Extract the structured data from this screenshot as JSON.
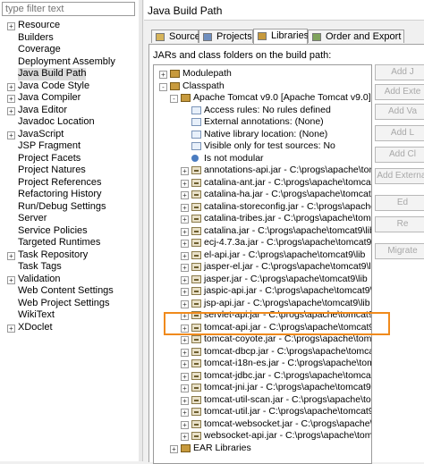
{
  "filter": {
    "placeholder": "type filter text"
  },
  "nav": [
    {
      "label": "Resource",
      "exp": "+"
    },
    {
      "label": "Builders",
      "exp": ""
    },
    {
      "label": "Coverage",
      "exp": ""
    },
    {
      "label": "Deployment Assembly",
      "exp": ""
    },
    {
      "label": "Java Build Path",
      "exp": "",
      "selected": true
    },
    {
      "label": "Java Code Style",
      "exp": "+"
    },
    {
      "label": "Java Compiler",
      "exp": "+"
    },
    {
      "label": "Java Editor",
      "exp": "+"
    },
    {
      "label": "Javadoc Location",
      "exp": ""
    },
    {
      "label": "JavaScript",
      "exp": "+"
    },
    {
      "label": "JSP Fragment",
      "exp": ""
    },
    {
      "label": "Project Facets",
      "exp": ""
    },
    {
      "label": "Project Natures",
      "exp": ""
    },
    {
      "label": "Project References",
      "exp": ""
    },
    {
      "label": "Refactoring History",
      "exp": ""
    },
    {
      "label": "Run/Debug Settings",
      "exp": ""
    },
    {
      "label": "Server",
      "exp": ""
    },
    {
      "label": "Service Policies",
      "exp": ""
    },
    {
      "label": "Targeted Runtimes",
      "exp": ""
    },
    {
      "label": "Task Repository",
      "exp": "+"
    },
    {
      "label": "Task Tags",
      "exp": ""
    },
    {
      "label": "Validation",
      "exp": "+"
    },
    {
      "label": "Web Content Settings",
      "exp": ""
    },
    {
      "label": "Web Project Settings",
      "exp": ""
    },
    {
      "label": "WikiText",
      "exp": ""
    },
    {
      "label": "XDoclet",
      "exp": "+"
    }
  ],
  "header": {
    "title": "Java Build Path"
  },
  "tabs": [
    {
      "label": "Source",
      "icon": "source-icon"
    },
    {
      "label": "Projects",
      "icon": "projects-icon"
    },
    {
      "label": "Libraries",
      "icon": "libraries-icon",
      "active": true
    },
    {
      "label": "Order and Export",
      "icon": "order-icon"
    }
  ],
  "content": {
    "jars_label": "JARs and class folders on the build path:"
  },
  "tree": [
    {
      "level": 0,
      "exp": "+",
      "icon": "lib",
      "text": "Modulepath"
    },
    {
      "level": 0,
      "exp": "-",
      "icon": "lib",
      "text": "Classpath"
    },
    {
      "level": 1,
      "exp": "-",
      "icon": "lib",
      "text": "Apache Tomcat v9.0 [Apache Tomcat v9.0]"
    },
    {
      "level": 2,
      "exp": "",
      "icon": "cross",
      "text": "Access rules: No rules defined"
    },
    {
      "level": 2,
      "exp": "",
      "icon": "cross",
      "text": "External annotations: (None)"
    },
    {
      "level": 2,
      "exp": "",
      "icon": "cross",
      "text": "Native library location: (None)"
    },
    {
      "level": 2,
      "exp": "",
      "icon": "cross",
      "text": "Visible only for test sources: No"
    },
    {
      "level": 2,
      "exp": "",
      "icon": "dot",
      "text": "Is not modular"
    },
    {
      "level": 2,
      "exp": "+",
      "icon": "jar",
      "text": "annotations-api.jar - C:\\progs\\apache\\tomcat"
    },
    {
      "level": 2,
      "exp": "+",
      "icon": "jar",
      "text": "catalina-ant.jar - C:\\progs\\apache\\tomcat9\\li"
    },
    {
      "level": 2,
      "exp": "+",
      "icon": "jar",
      "text": "catalina-ha.jar - C:\\progs\\apache\\tomcat9\\lib"
    },
    {
      "level": 2,
      "exp": "+",
      "icon": "jar",
      "text": "catalina-storeconfig.jar - C:\\progs\\apache\\to"
    },
    {
      "level": 2,
      "exp": "+",
      "icon": "jar",
      "text": "catalina-tribes.jar - C:\\progs\\apache\\tomca"
    },
    {
      "level": 2,
      "exp": "+",
      "icon": "jar",
      "text": "catalina.jar - C:\\progs\\apache\\tomcat9\\lib"
    },
    {
      "level": 2,
      "exp": "+",
      "icon": "jar",
      "text": "ecj-4.7.3a.jar - C:\\progs\\apache\\tomcat9\\lib"
    },
    {
      "level": 2,
      "exp": "+",
      "icon": "jar",
      "text": "el-api.jar - C:\\progs\\apache\\tomcat9\\lib"
    },
    {
      "level": 2,
      "exp": "+",
      "icon": "jar",
      "text": "jasper-el.jar - C:\\progs\\apache\\tomcat9\\lib"
    },
    {
      "level": 2,
      "exp": "+",
      "icon": "jar",
      "text": "jasper.jar - C:\\progs\\apache\\tomcat9\\lib"
    },
    {
      "level": 2,
      "exp": "+",
      "icon": "jar",
      "text": "jaspic-api.jar - C:\\progs\\apache\\tomcat9\\lib"
    },
    {
      "level": 2,
      "exp": "+",
      "icon": "jar",
      "text": "jsp-api.jar - C:\\progs\\apache\\tomcat9\\lib"
    },
    {
      "level": 2,
      "exp": "+",
      "icon": "jar",
      "text": "servlet-api.jar - C:\\progs\\apache\\tomcat9\\lib"
    },
    {
      "level": 2,
      "exp": "+",
      "icon": "jar",
      "text": "tomcat-api.jar - C:\\progs\\apache\\tomcat9\\lib"
    },
    {
      "level": 2,
      "exp": "+",
      "icon": "jar",
      "text": "tomcat-coyote.jar - C:\\progs\\apache\\tomcat9"
    },
    {
      "level": 2,
      "exp": "+",
      "icon": "jar",
      "text": "tomcat-dbcp.jar - C:\\progs\\apache\\tomcat9\\lib"
    },
    {
      "level": 2,
      "exp": "+",
      "icon": "jar",
      "text": "tomcat-i18n-es.jar - C:\\progs\\apache\\tomcat9"
    },
    {
      "level": 2,
      "exp": "+",
      "icon": "jar",
      "text": "tomcat-jdbc.jar - C:\\progs\\apache\\tomcat9\\lib"
    },
    {
      "level": 2,
      "exp": "+",
      "icon": "jar",
      "text": "tomcat-jni.jar - C:\\progs\\apache\\tomcat9\\lib"
    },
    {
      "level": 2,
      "exp": "+",
      "icon": "jar",
      "text": "tomcat-util-scan.jar - C:\\progs\\apache\\tomcat"
    },
    {
      "level": 2,
      "exp": "+",
      "icon": "jar",
      "text": "tomcat-util.jar - C:\\progs\\apache\\tomcat9\\lib"
    },
    {
      "level": 2,
      "exp": "+",
      "icon": "jar",
      "text": "tomcat-websocket.jar - C:\\progs\\apache\\tomca"
    },
    {
      "level": 2,
      "exp": "+",
      "icon": "jar",
      "text": "websocket-api.jar - C:\\progs\\apache\\tomcat9\\"
    },
    {
      "level": 1,
      "exp": "+",
      "icon": "lib",
      "text": "EAR Libraries"
    }
  ],
  "buttons": [
    "Add J",
    "Add Exte",
    "Add Va",
    "Add L",
    "Add Cl",
    "Add External",
    "Ed",
    "Re",
    "Migrate"
  ],
  "colors": {
    "highlight": "#f08a1c"
  }
}
